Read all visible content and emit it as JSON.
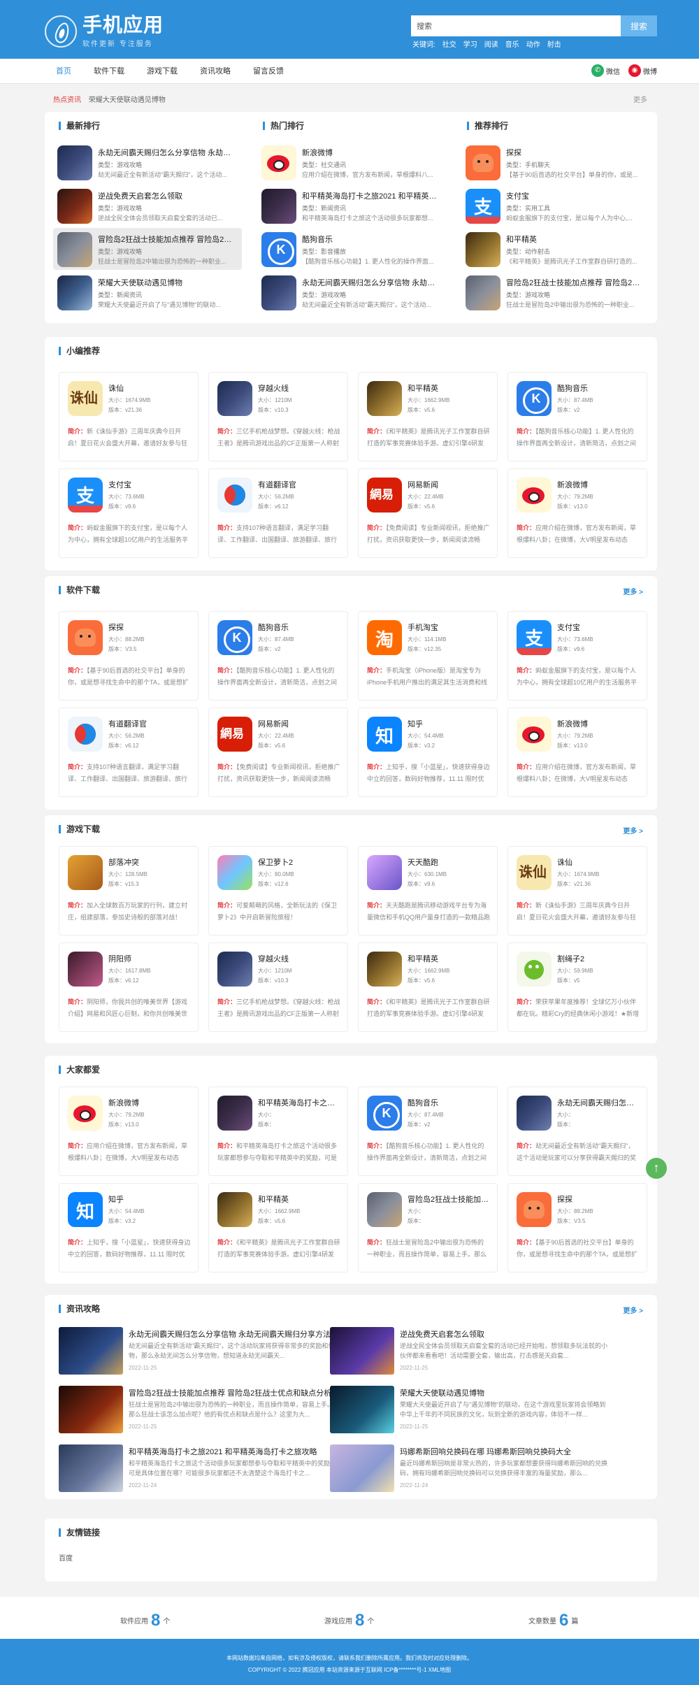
{
  "header": {
    "logo_title": "手机应用",
    "logo_sub": "软件更新  专注服务",
    "search_value": "搜索",
    "search_button": "搜索",
    "hotwords_label": "关键词:",
    "hotwords": [
      "社交",
      "学习",
      "阅读",
      "音乐",
      "动作",
      "射击"
    ]
  },
  "nav": {
    "items": [
      "首页",
      "软件下载",
      "游戏下载",
      "资讯攻略",
      "留言反馈"
    ],
    "share_wechat": "微信",
    "share_weibo": "微博"
  },
  "ticker": {
    "label": "热点资讯",
    "text": "荣耀大天使联动遇见博物",
    "more": "更多"
  },
  "rankings": {
    "columns": [
      {
        "title": "最新排行",
        "items": [
          {
            "icon": "game1",
            "name": "永劫无间霸天赐归怎么分享信物 永劫无间霸天赐归分享方法",
            "type": "类型：游戏攻略",
            "desc": "劫无间最近全有新活动\"霸天赐归\"，这个活动..."
          },
          {
            "icon": "game2",
            "name": "逆战免费天启套怎么领取",
            "type": "类型：游戏攻略",
            "desc": "逆战全民全体会员领取天启套全套的活动已..."
          },
          {
            "icon": "game3",
            "name": "冒险岛2狂战士技能加点推荐 冒险岛2狂战士",
            "type": "类型：游戏攻略",
            "desc": "狂战士是冒险岛2中输出很为恐怖的一种职业..."
          },
          {
            "icon": "game4",
            "name": "荣耀大天使联动遇见博物",
            "type": "类型：新闻资讯",
            "desc": "荣耀大天使最近开启了与\"遇见博物\"的联动..."
          }
        ]
      },
      {
        "title": "热门排行",
        "items": [
          {
            "icon": "weibo",
            "name": "新浪微博",
            "type": "类型：社交通讯",
            "desc": "应用介绍在微博，官方发布新闻，草根爆料八..."
          },
          {
            "icon": "game5",
            "name": "和平精英海岛打卡之旅2021 和平精英海岛",
            "type": "类型：新闻资讯",
            "desc": "和平精英海岛打卡之旅这个活动很多玩家都想..."
          },
          {
            "icon": "kugou",
            "name": "酷狗音乐",
            "type": "类型：影音播放",
            "desc": "【酷狗音乐核心功能】1. 更人性化的操作界面..."
          },
          {
            "icon": "game1",
            "name": "永劫无间霸天赐归怎么分享信物 永劫无间霸天赐归分享方法",
            "type": "类型：游戏攻略",
            "desc": "劫无间最近全有新活动\"霸天赐归\"，这个活动..."
          }
        ]
      },
      {
        "title": "推荐排行",
        "items": [
          {
            "icon": "tantan",
            "name": "探探",
            "type": "类型：手机聊天",
            "desc": "【基于90后首选的社交平台】单身的你，或是..."
          },
          {
            "icon": "alipay",
            "name": "支付宝",
            "type": "类型：实用工具",
            "desc": "蚂蚁金服旗下的支付宝，是以每个人为中心,..."
          },
          {
            "icon": "game6",
            "name": "和平精英",
            "type": "类型：动作射击",
            "desc": "《和平精英》是腾讯光子工作室群自研打造的..."
          },
          {
            "icon": "game3",
            "name": "冒险岛2狂战士技能加点推荐 冒险岛2狂战士",
            "type": "类型：游戏攻略",
            "desc": "狂战士是冒险岛2中输出很为恐怖的一种职业..."
          }
        ]
      }
    ]
  },
  "sections": [
    {
      "title": "小编推荐",
      "more": "",
      "apps": [
        {
          "icon": "zhuxian",
          "name": "诛仙",
          "size": "大小：1674.9MB",
          "ver": "版本：v21.36",
          "desc": "新《诛仙手游》三周年庆典今日开启！夏日花火会盛大开幕，邀请好友参与狂欢"
        },
        {
          "icon": "game1",
          "name": "穿越火线",
          "size": "大小：1210M",
          "ver": "版本：v10.3",
          "desc": "三亿手机枪战梦想。《穿越火线：枪战王者》是腾讯游戏出品的CF正版第一人称射击手游"
        },
        {
          "icon": "game6",
          "name": "和平精英",
          "size": "大小：1662.9MB",
          "ver": "版本：v5.6",
          "desc": "《和平精英》是腾讯光子工作室群自研打造的军事竞赛体验手游。虚幻引擎4研发"
        },
        {
          "icon": "kugou",
          "name": "酷狗音乐",
          "size": "大小：87.4MB",
          "ver": "版本：v2",
          "desc": "【酷狗音乐核心功能】1. 更人性化的操作界面再全新设计，清新简洁，点划之间"
        },
        {
          "icon": "alipay",
          "name": "支付宝",
          "size": "大小：73.6MB",
          "ver": "版本：v9.6",
          "desc": "蚂蚁金服旗下的支付宝，是以每个人为中心，拥有全球超10亿用户的生活服务平台"
        },
        {
          "icon": "youdao",
          "name": "有道翻译官",
          "size": "大小：56.2MB",
          "ver": "版本：v6.12",
          "desc": "支持107种语言翻译，满足学习翻译、工作翻译、出国翻译、旅游翻译、旅行翻译"
        },
        {
          "icon": "wangyi",
          "name": "网易新闻",
          "size": "大小：22.4MB",
          "ver": "版本：v5.6",
          "desc": "【免费阅读】专业新闻视讯，拒绝推广打扰，资讯获取更快一步，新闻阅读流畅"
        },
        {
          "icon": "weibo",
          "name": "新浪微博",
          "size": "大小：79.2MB",
          "ver": "版本：v13.0",
          "desc": "应用介绍在微博，官方发布新闻，草根爆料八卦；在微博，大V明星发布动态"
        }
      ]
    },
    {
      "title": "软件下载",
      "more": "更多 >",
      "apps": [
        {
          "icon": "tantan",
          "name": "探探",
          "size": "大小：88.2MB",
          "ver": "版本：V3.5",
          "desc": "【基于90后首选的社交平台】单身的你，或是想寻找生命中的那个TA，或是想扩大社交圈"
        },
        {
          "icon": "kugou",
          "name": "酷狗音乐",
          "size": "大小：87.4MB",
          "ver": "版本：v2",
          "desc": "【酷狗音乐核心功能】1. 更人性化的操作界面再全新设计，清新简洁，点划之间"
        },
        {
          "icon": "taobao",
          "name": "手机淘宝",
          "size": "大小：114.1MB",
          "ver": "版本：v12.35",
          "desc": "手机淘宝（iPhone版）是淘宝专为iPhone手机用户推出的满足其生活消费和线上购物需求"
        },
        {
          "icon": "alipay",
          "name": "支付宝",
          "size": "大小：73.6MB",
          "ver": "版本：v9.6",
          "desc": "蚂蚁金服旗下的支付宝，是以每个人为中心，拥有全球超10亿用户的生活服务平台"
        },
        {
          "icon": "youdao",
          "name": "有道翻译官",
          "size": "大小：56.2MB",
          "ver": "版本：v6.12",
          "desc": "支持107种语言翻译，满足学习翻译、工作翻译、出国翻译、旅游翻译、旅行翻译"
        },
        {
          "icon": "wangyi",
          "name": "网易新闻",
          "size": "大小：22.4MB",
          "ver": "版本：v5.6",
          "desc": "【免费阅读】专业新闻视讯，拒绝推广打扰，资讯获取更快一步，新闻阅读流畅"
        },
        {
          "icon": "zhihu",
          "name": "知乎",
          "size": "大小：54.4MB",
          "ver": "版本：v3.2",
          "desc": "上知乎，搜「小蓝星」，快速获得身边中立的回答，数码好物推荐，11.11 限时优惠"
        },
        {
          "icon": "weibo",
          "name": "新浪微博",
          "size": "大小：79.2MB",
          "ver": "版本：v13.0",
          "desc": "应用介绍在微博，官方发布新闻，草根爆料八卦；在微博，大V明星发布动态"
        }
      ]
    },
    {
      "title": "游戏下载",
      "more": "更多 >",
      "apps": [
        {
          "icon": "coc",
          "name": "部落冲突",
          "size": "大小：128.5MB",
          "ver": "版本：v15.3",
          "desc": "加入全球数百万玩家的行列，建立村庄，组建部落，参加史诗般的部落对战！"
        },
        {
          "icon": "baowei",
          "name": "保卫萝卜2",
          "size": "大小：80.0MB",
          "ver": "版本：v12.6",
          "desc": "可爱颠萌的风格，全新玩法的《保卫萝卜2》中开启新冒险旅程！"
        },
        {
          "icon": "tianti",
          "name": "天天酷跑",
          "size": "大小：630.1MB",
          "ver": "版本：v9.6",
          "desc": "天天酷跑是腾讯移动游戏平台专为海量微信和手机QQ用户量身打造的一款精品跑酷手游"
        },
        {
          "icon": "zhuxian",
          "name": "诛仙",
          "size": "大小：1674.9MB",
          "ver": "版本：v21.36",
          "desc": "新《诛仙手游》三周年庆典今日开启！夏日花火会盛大开幕，邀请好友参与狂欢"
        },
        {
          "icon": "yinyang",
          "name": "阴阳师",
          "size": "大小：1617.8MB",
          "ver": "版本：v6.12",
          "desc": "阴阳师，你我共创的唯美世界【游戏介绍】网易和风匠心巨制，和你共创唯美世界"
        },
        {
          "icon": "game1",
          "name": "穿越火线",
          "size": "大小：1210M",
          "ver": "版本：v10.3",
          "desc": "三亿手机枪战梦想。《穿越火线：枪战王者》是腾讯游戏出品的CF正版第一人称射击手游"
        },
        {
          "icon": "game6",
          "name": "和平精英",
          "size": "大小：1662.9MB",
          "ver": "版本：v5.6",
          "desc": "《和平精英》是腾讯光子工作室群自研打造的军事竞赛体验手游。虚幻引擎4研发"
        },
        {
          "icon": "cut",
          "name": "割绳子2",
          "size": "大小：59.9MB",
          "ver": "版本：v5",
          "desc": "荣获苹果年度推荐！全球亿万小伙伴都在玩。精彩Cry的经典休闲小游戏！★新增的模式"
        }
      ]
    },
    {
      "title": "大家都爱",
      "more": "",
      "apps": [
        {
          "icon": "weibo",
          "name": "新浪微博",
          "size": "大小：79.2MB",
          "ver": "版本：v13.0",
          "desc": "应用介绍在微博，官方发布新闻，草根爆料八卦；在微博，大V明星发布动态"
        },
        {
          "icon": "game5",
          "name": "和平精英海岛打卡之旅2021 和平精英海岛",
          "size": "大小：",
          "ver": "版本：",
          "desc": "和平精英海岛打卡之旅这个活动很多玩家都想参与夺取和平精英中的奖励，可是具体"
        },
        {
          "icon": "kugou",
          "name": "酷狗音乐",
          "size": "大小：87.4MB",
          "ver": "版本：v2",
          "desc": "【酷狗音乐核心功能】1. 更人性化的操作界面再全新设计，清新简洁，点划之间"
        },
        {
          "icon": "game1",
          "name": "永劫无间霸天赐归怎么分享信物 永劫无间霸天赐归分享方法",
          "size": "大小：",
          "ver": "版本：",
          "desc": "劫无间最近全有新活动\"霸天赐归\"，这个活动是玩家可以分享获得霸天赐归的奖励和信物"
        },
        {
          "icon": "zhihu",
          "name": "知乎",
          "size": "大小：54.4MB",
          "ver": "版本：v3.2",
          "desc": "上知乎，搜「小蓝星」，快速获得身边中立的回答，数码好物推荐，11.11 限时优惠"
        },
        {
          "icon": "game6",
          "name": "和平精英",
          "size": "大小：1662.9MB",
          "ver": "版本：v5.6",
          "desc": "《和平精英》是腾讯光子工作室群自研打造的军事竞赛体验手游。虚幻引擎4研发"
        },
        {
          "icon": "game3",
          "name": "冒险岛2狂战士技能加点推荐 冒险岛2狂战士",
          "size": "大小：",
          "ver": "版本：",
          "desc": "狂战士是冒险岛2中输出很为恐怖的一种职业，而且操作简单，容易上手。那么"
        },
        {
          "icon": "tantan",
          "name": "探探",
          "size": "大小：88.2MB",
          "ver": "版本：V3.5",
          "desc": "【基于90后首选的社交平台】单身的你，或是想寻找生命中的那个TA，或是想扩大社交圈"
        }
      ]
    }
  ],
  "news": {
    "title": "资讯攻略",
    "more": "更多 >",
    "items": [
      {
        "img": "1",
        "title": "永劫无间霸天赐归怎么分享信物 永劫无间霸天赐归分享方法",
        "desc": "劫无间最近全有新活动\"霸天赐归\"，这个活动玩家将获得非常多的奖励和信物，那么永劫无间怎么分享信物，想知道永劫无间霸天...",
        "date": "2022-11-25"
      },
      {
        "img": "2",
        "title": "逆战免费天启套怎么领取",
        "desc": "逆战全民全体会员领取天启套全套的活动已经开始啦，想领取多玩法就的小伙伴都来看看吧！活动需要全套，输出高，打击感是天启套...",
        "date": "2022-11-25"
      },
      {
        "img": "3",
        "title": "冒险岛2狂战士技能加点推荐 冒险岛2狂战士优点和缺点分析",
        "desc": "狂战士是冒险岛2中输出很为恐怖的一种职业，而且操作简单，容易上手。那么狂战士该怎么加点呢？他的有优点和缺点是什么？这里为大...",
        "date": "2022-11-25"
      },
      {
        "img": "4",
        "title": "荣耀大天使联动遇见博物",
        "desc": "荣耀大天使最近开启了与\"遇见博物\"的联动，在这个游戏里玩家将会领略到中华上千年的不同民族的文化，玩到全新的游戏内容，体验不一样...",
        "date": "2022-11-25"
      },
      {
        "img": "5",
        "title": "和平精英海岛打卡之旅2021 和平精英海岛打卡之旅攻略",
        "desc": "和平精英海岛打卡之旅这个活动很多玩家都想参与夺取和平精英中的奖励，可是具体位置在哪？可能很多玩家都还不太清楚这个海岛打卡之...",
        "date": "2022-11-24"
      },
      {
        "img": "6",
        "title": "玛娜希斯回响兑换码在哪 玛娜希斯回响兑换码大全",
        "desc": "最近玛娜希斯回响是非常火热的，许多玩家都想要获得玛娜希斯回响的兑换码，拥有玛娜希斯回响兑换码可以兑换获得丰富的海量奖励，那么...",
        "date": "2022-11-24"
      }
    ]
  },
  "friends": {
    "title": "友情链接",
    "links": [
      "百度"
    ]
  },
  "stats": [
    {
      "label": "软件应用",
      "value": "8",
      "unit": "个"
    },
    {
      "label": "游戏应用",
      "value": "8",
      "unit": "个"
    },
    {
      "label": "文章数量",
      "value": "6",
      "unit": "篇"
    }
  ],
  "footer": {
    "line1": "本网站数据均来自网络，如有涉及侵权版权，请联系我们删除所属应用。我们将及时对应处理删除。",
    "line2": "COPYRIGHT © 2022 腾冠应用 本站资源来源于互联网 ICP备********号-1 XML地图"
  },
  "totop_icon": "arrow-up-icon"
}
